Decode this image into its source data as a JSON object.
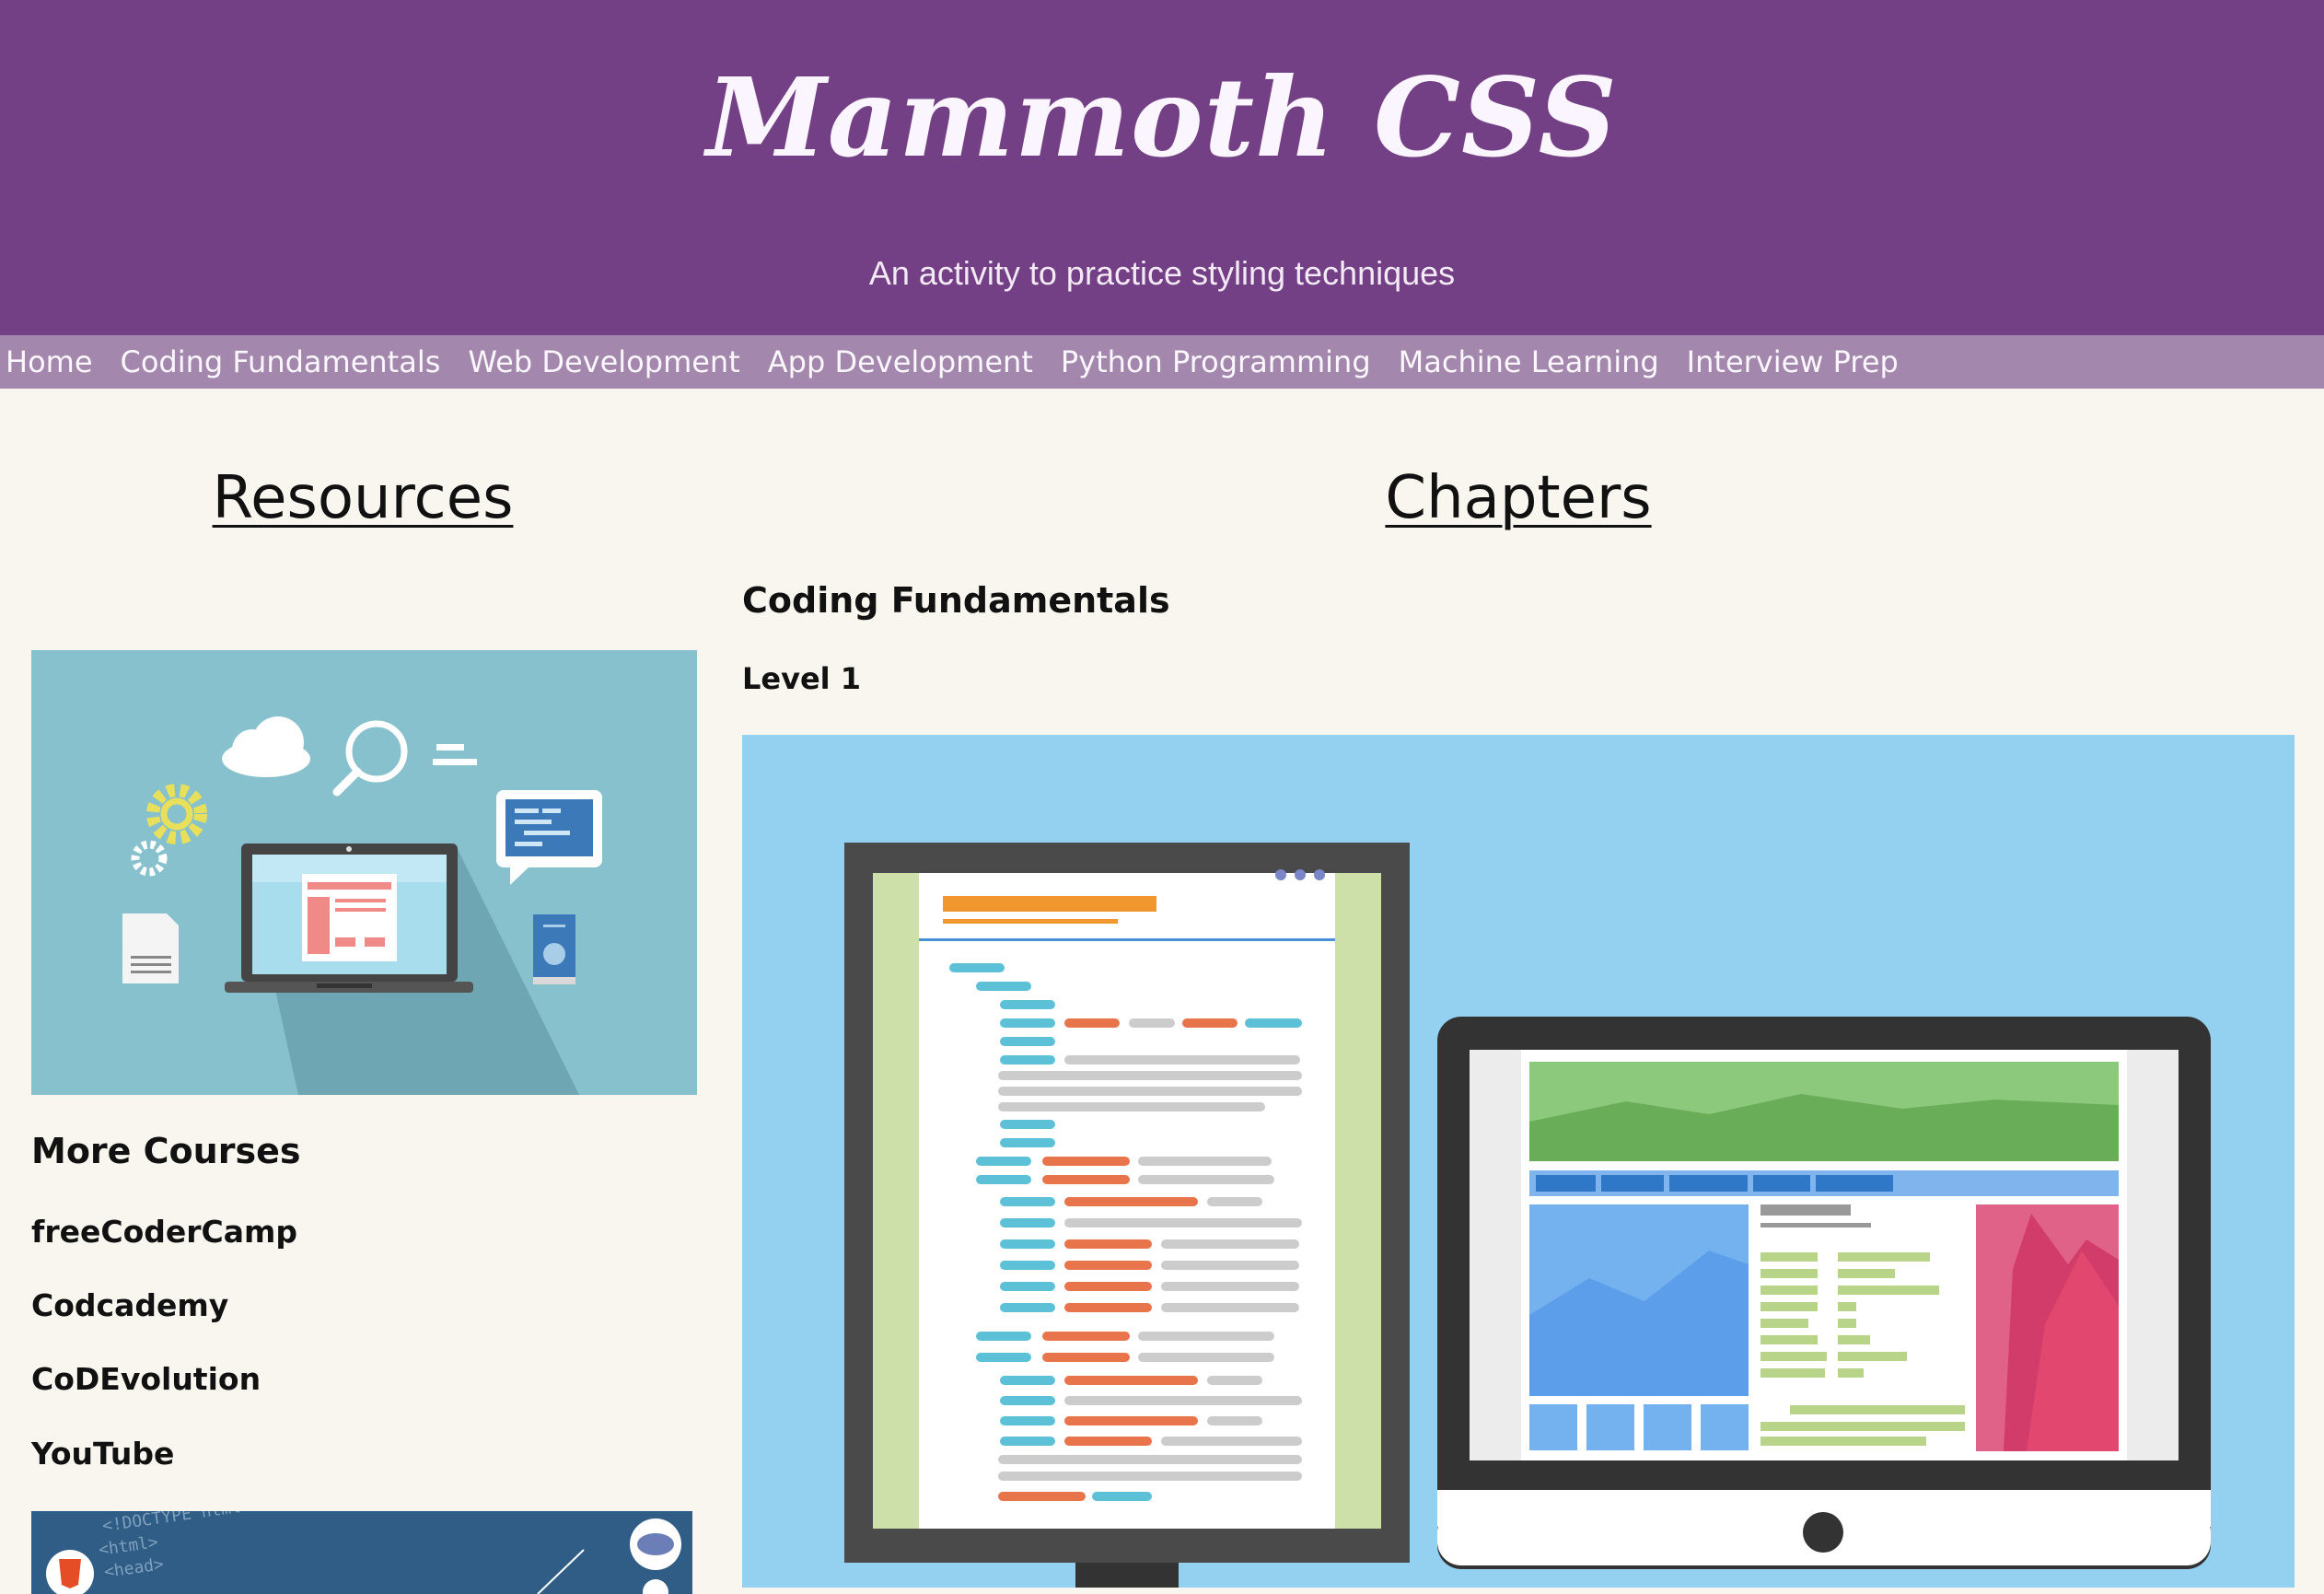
{
  "header": {
    "title": "Mammoth CSS",
    "subtitle": "An activity to practice styling techniques",
    "background": "#733f85"
  },
  "nav": {
    "background": "#a487ad",
    "items": [
      {
        "label": "Home"
      },
      {
        "label": "Coding Fundamentals"
      },
      {
        "label": "Web Development"
      },
      {
        "label": "App Development"
      },
      {
        "label": "Python Programming"
      },
      {
        "label": "Machine Learning"
      },
      {
        "label": "Interview Prep"
      }
    ]
  },
  "sidebar": {
    "heading": "Resources",
    "more_courses_title": "More Courses",
    "courses": [
      {
        "label": "freeCoderCamp"
      },
      {
        "label": "Codcademy"
      },
      {
        "label": "CoDEvolution"
      },
      {
        "label": "YouTube"
      }
    ],
    "code_thumb_text": [
      "<!DOCTYPE html>",
      "<html>",
      "<head>"
    ]
  },
  "main": {
    "heading": "Chapters",
    "chapter_title": "Coding Fundamentals",
    "level_title": "Level 1"
  },
  "icons": [
    "cloud-icon",
    "magnifier-icon",
    "gear-icon",
    "document-icon",
    "laptop-icon",
    "chat-bubble-icon",
    "phone-icon",
    "html5-icon",
    "php-icon"
  ]
}
